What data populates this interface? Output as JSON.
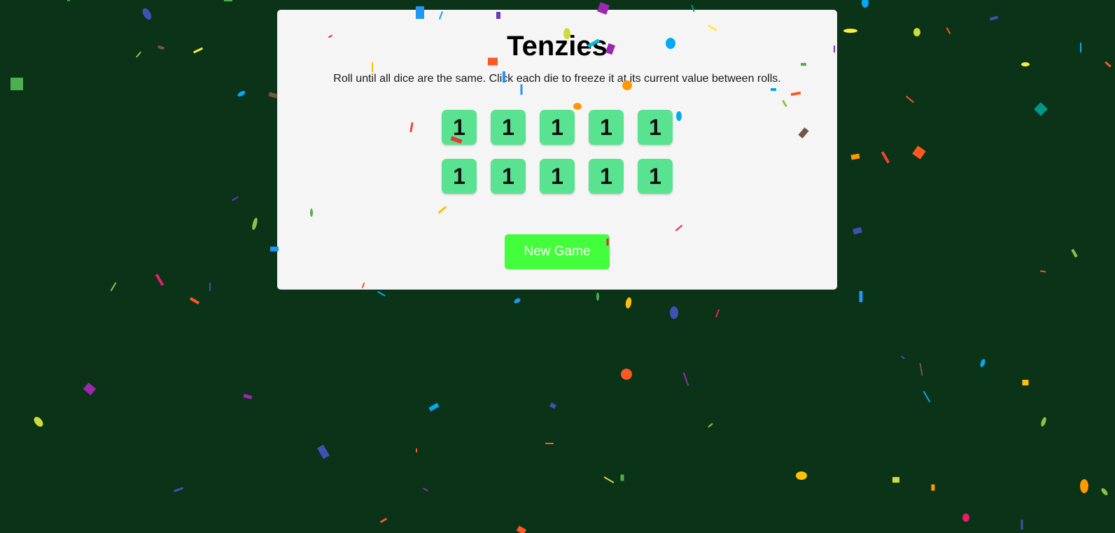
{
  "game": {
    "title": "Tenzies",
    "instructions": "Roll until all dice are the same. Click each die to freeze it at its current value between rolls.",
    "dice": [
      "1",
      "1",
      "1",
      "1",
      "1",
      "1",
      "1",
      "1",
      "1",
      "1"
    ],
    "new_game_label": "New Game"
  },
  "colors": {
    "background": "#0b3318",
    "card": "#f5f5f5",
    "die": "#59e391",
    "button": "#43fe3a"
  }
}
